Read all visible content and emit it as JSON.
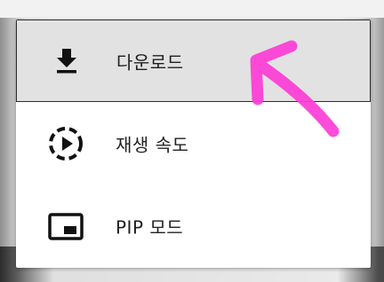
{
  "menu": {
    "items": [
      {
        "label": "다운로드",
        "icon": "download-icon"
      },
      {
        "label": "재생 속도",
        "icon": "playback-speed-icon"
      },
      {
        "label": "PIP 모드",
        "icon": "picture-in-picture-icon"
      }
    ]
  },
  "colors": {
    "highlight_background": "#e2e2e2",
    "annotation_arrow": "#ff3cd6"
  }
}
